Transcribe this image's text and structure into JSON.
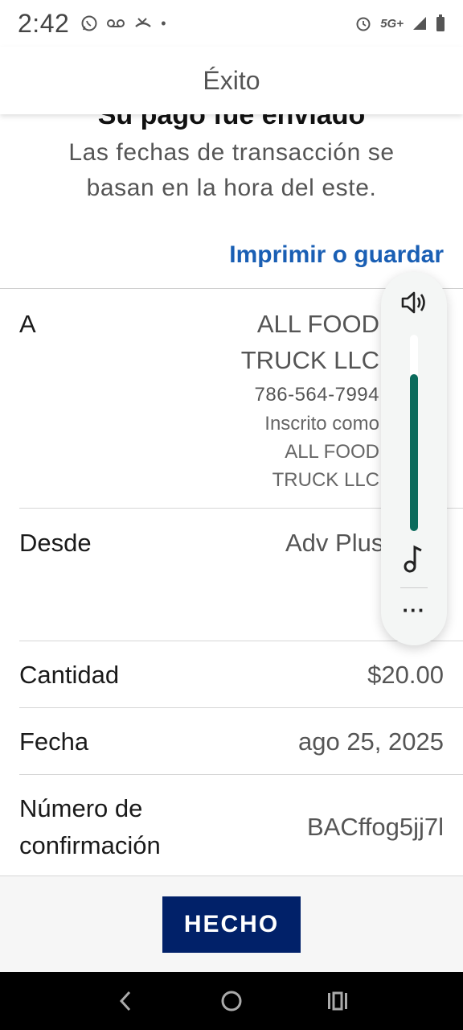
{
  "status_bar": {
    "time": "2:42",
    "network": "5G+"
  },
  "app_bar": {
    "title": "Éxito"
  },
  "header": {
    "clipped_heading": "Su pago fue enviado",
    "subtitle": "Las fechas de transacción se basan en la hora del este.",
    "print_link": "Imprimir o guardar"
  },
  "details": {
    "to": {
      "label": "A",
      "name_line1": "ALL FOOD",
      "name_line2": "TRUCK LLC",
      "phone": "786-564-7994",
      "registered_line1": "Inscrito como",
      "registered_line2": "ALL FOOD",
      "registered_line3": "TRUCK LLC"
    },
    "from": {
      "label": "Desde",
      "value": "Adv Plus Banl"
    },
    "amount": {
      "label": "Cantidad",
      "value": "$20.00"
    },
    "date": {
      "label": "Fecha",
      "value": "ago 25, 2025"
    },
    "confirmation": {
      "label_line1": "Número de",
      "label_line2": "confirmación",
      "value": "BACffog5jj7l"
    }
  },
  "footer": {
    "done_label": "HECHO"
  },
  "volume_panel": {
    "level": 0.8,
    "accent_color": "#0b6b5c",
    "more_label": "···"
  },
  "colors": {
    "primary_button": "#012169",
    "link": "#1a5fb4"
  }
}
